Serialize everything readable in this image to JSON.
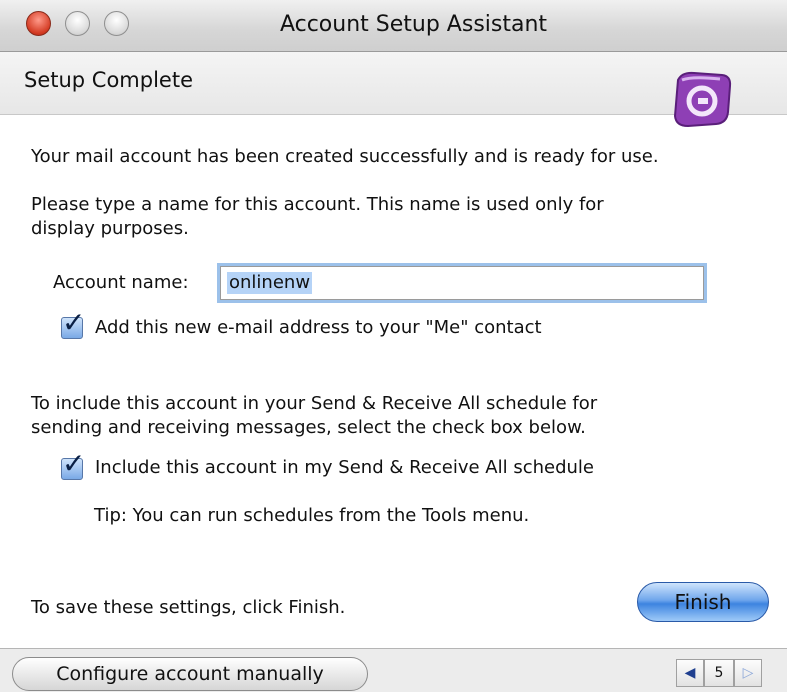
{
  "window": {
    "title": "Account Setup Assistant"
  },
  "header": {
    "step_title": "Setup Complete",
    "logo_icon": "entourage-logo-icon"
  },
  "body": {
    "success_message": "Your mail account has been created successfully and is ready for use.",
    "name_instructions_line1": "Please type a name for this account. This name is used only for",
    "name_instructions_line2": "display purposes.",
    "account_name_label": "Account name:",
    "account_name_value": "onlinenw",
    "me_contact_checkbox": {
      "label": "Add this new e-mail address to your \"Me\" contact",
      "checked": true
    },
    "schedule_instructions_line1": "To include this account in your Send & Receive All schedule for",
    "schedule_instructions_line2": "sending and receiving messages, select the check box below.",
    "schedule_checkbox": {
      "label": "Include this account in my Send & Receive All schedule",
      "checked": true
    },
    "tip": "Tip: You can run schedules from the Tools menu.",
    "save_instruction": "To save these settings, click Finish."
  },
  "buttons": {
    "finish": "Finish",
    "configure_manually": "Configure account manually"
  },
  "pager": {
    "page": "5",
    "prev_icon": "left-arrow-icon",
    "next_icon": "right-arrow-icon"
  },
  "colors": {
    "accent": "#3d84e0",
    "logo": "#8e3fb5"
  }
}
